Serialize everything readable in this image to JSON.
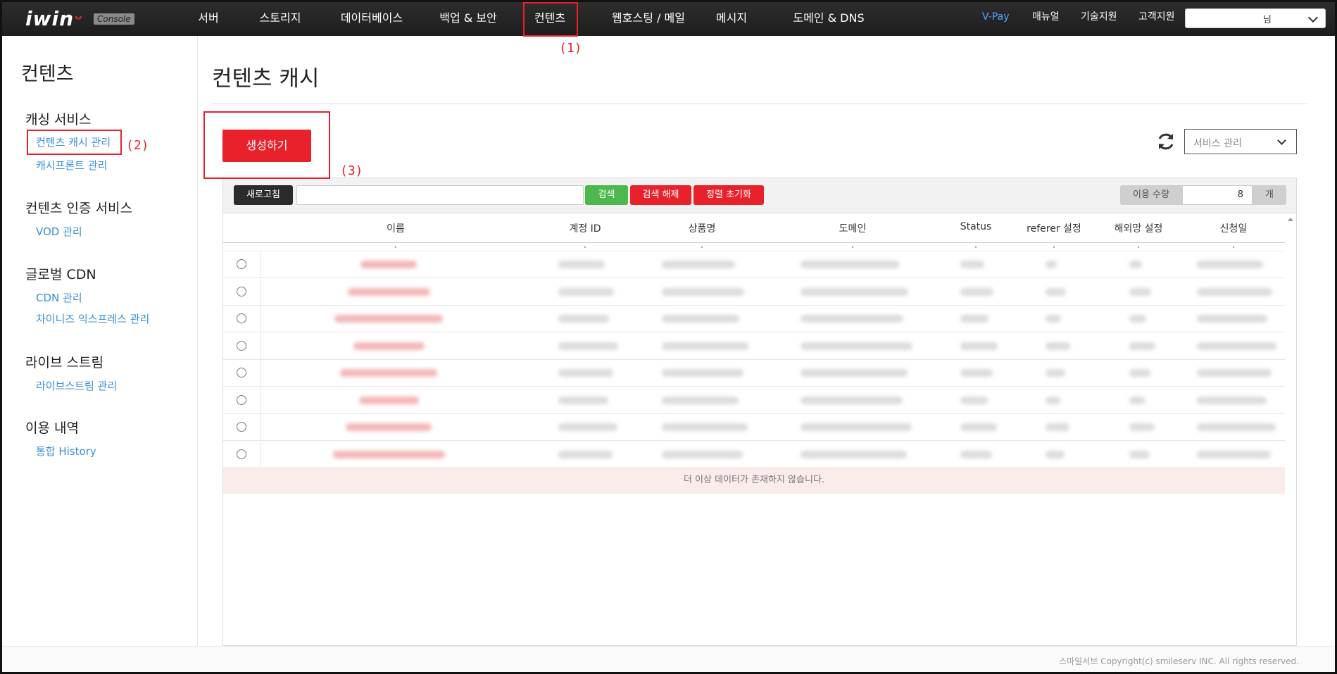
{
  "brand": {
    "logo_text": "iwin",
    "badge": "Console"
  },
  "topnav": {
    "items": [
      {
        "label": "서버"
      },
      {
        "label": "스토리지"
      },
      {
        "label": "데이터베이스"
      },
      {
        "label": "백업 & 보안"
      },
      {
        "label": "컨텐츠"
      },
      {
        "label": "웹호스팅 / 메일"
      },
      {
        "label": "메시지"
      },
      {
        "label": "도메인 & DNS"
      }
    ],
    "right": {
      "vpay": "V-Pay",
      "manual": "매뉴얼",
      "tech": "기술지원",
      "support": "고객지원"
    },
    "user": "님"
  },
  "sidebar": {
    "title": "컨텐츠",
    "groups": [
      {
        "title": "캐싱 서비스",
        "links": [
          "컨텐츠 캐시 관리",
          "캐시프론트 관리"
        ]
      },
      {
        "title": "컨텐츠 인증 서비스",
        "links": [
          "VOD 관리"
        ]
      },
      {
        "title": "글로벌 CDN",
        "links": [
          "CDN 관리",
          "차이니즈 익스프레스 관리"
        ]
      },
      {
        "title": "라이브 스트림",
        "links": [
          "라이브스트림 관리"
        ]
      },
      {
        "title": "이용 내역",
        "links": [
          "통합 History"
        ]
      }
    ]
  },
  "main": {
    "title": "컨텐츠 캐시",
    "create_button": "생성하기",
    "service_select": "서비스 관리",
    "toolbar": {
      "refresh": "새로고침",
      "search_value": "",
      "search": "검색",
      "clear": "검색 해제",
      "reset_sort": "정렬 초기화",
      "usage_label": "이용 수량",
      "usage_value": "8",
      "usage_unit": "개"
    },
    "columns": [
      "이름",
      "계정 ID",
      "상품명",
      "도메인",
      "Status",
      "referer 설정",
      "해외망 설정",
      "신청일"
    ],
    "row_count": 8,
    "no_more_data": "더 이상 데이터가 존재하지 않습니다."
  },
  "annotations": [
    "(1)",
    "(2)",
    "(3)"
  ],
  "footer": {
    "copyright": "스마일서브 Copyright(c) smileserv INC. All rights reserved."
  },
  "colors": {
    "accent": "#e8212b",
    "link": "#3a8fd9",
    "green": "#4db84d",
    "nav_bg": "#262626"
  }
}
